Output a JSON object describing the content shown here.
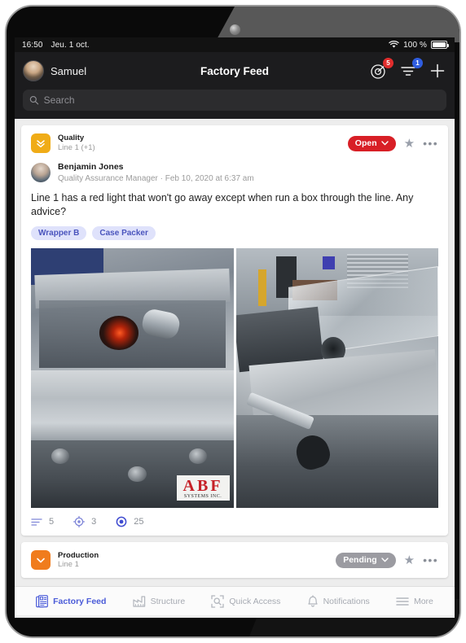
{
  "status_bar": {
    "time": "16:50",
    "date": "Jeu. 1 oct.",
    "battery_percent": "100 %",
    "wifi_icon": "wifi-icon",
    "battery_icon": "battery-icon"
  },
  "header": {
    "user_name": "Samuel",
    "title": "Factory Feed",
    "avatar_icon": "avatar",
    "actions": [
      {
        "name": "radar-icon",
        "badge": "5",
        "badge_color": "#e12d2d"
      },
      {
        "name": "filter-icon",
        "badge": "1",
        "badge_color": "#2f5de0"
      },
      {
        "name": "plus-icon",
        "badge": "",
        "badge_color": ""
      }
    ]
  },
  "search": {
    "placeholder": "Search",
    "value": "",
    "icon": "search-icon"
  },
  "feed": {
    "cards": [
      {
        "category": "Quality",
        "location": "Line 1 (+1)",
        "icon": "double-chevron-down-icon",
        "icon_color": "#f0ac17",
        "status": "Open",
        "status_color": "#d81f26",
        "star_icon": "star-icon",
        "more_icon": "more-dots-icon",
        "author": {
          "name": "Benjamin Jones",
          "meta": "Quality Assurance Manager · Feb 10, 2020 at 6:37 am",
          "avatar_icon": "author-avatar"
        },
        "body": "Line 1 has a red light that won't go away except when run a box through the line. Any advice?",
        "tags": [
          "Wrapper B",
          "Case Packer"
        ],
        "photos": [
          {
            "name": "photo-machine-red-light",
            "caption_logo": "ABF",
            "caption_sub": "SYSTEMS INC."
          },
          {
            "name": "photo-conveyor-line",
            "caption_logo": "",
            "caption_sub": ""
          }
        ],
        "stats": [
          {
            "icon": "comments-icon",
            "value": "5"
          },
          {
            "icon": "target-icon",
            "value": "3"
          },
          {
            "icon": "views-icon",
            "value": "25"
          }
        ]
      },
      {
        "category": "Production",
        "location": "Line 1",
        "icon": "chevron-down-icon",
        "icon_color": "#f07c1d",
        "status": "Pending",
        "status_color": "#9b9ba1",
        "star_icon": "star-icon",
        "more_icon": "more-dots-icon"
      }
    ]
  },
  "tab_bar": {
    "tabs": [
      {
        "label": "Factory Feed",
        "icon": "feed-document-icon",
        "active": true
      },
      {
        "label": "Structure",
        "icon": "factory-icon",
        "active": false
      },
      {
        "label": "Quick Access",
        "icon": "scan-search-icon",
        "active": false
      },
      {
        "label": "Notifications",
        "icon": "bell-icon",
        "active": false
      },
      {
        "label": "More",
        "icon": "hamburger-icon",
        "active": false
      }
    ]
  },
  "colors": {
    "accent_blue": "#4a5bd8",
    "status_open_red": "#d81f26",
    "status_pending_gray": "#9b9ba1",
    "quality_yellow": "#f0ac17",
    "production_orange": "#f07c1d",
    "tag_bg": "#dfe2fb",
    "tag_text": "#4a54bd"
  }
}
